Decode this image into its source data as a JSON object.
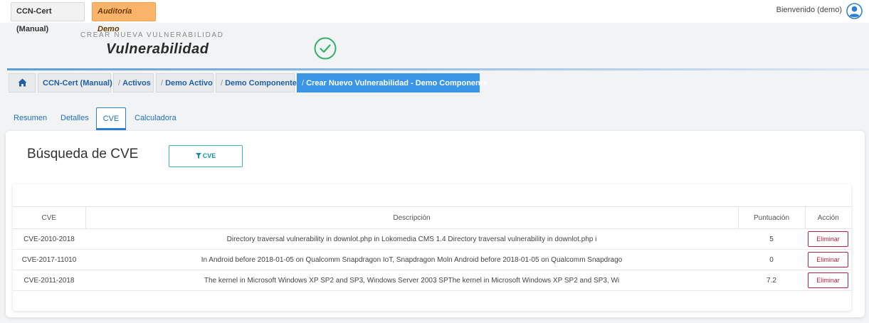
{
  "topbar": {
    "org_chip": "CCN-Cert (Manual)",
    "audit_chip": "Auditoría Demo",
    "welcome": "Bienvenido (demo)",
    "user_icon": "user-circle-icon"
  },
  "header": {
    "subtitle": "CREAR NUEVA VULNERABILIDAD",
    "title": "Vulnerabilidad",
    "status_icon": "check-circle-icon",
    "status_color": "#2fb36a"
  },
  "breadcrumb": {
    "home_icon": "home-icon",
    "items": [
      "CCN-Cert (Manual)",
      "Activos",
      "Demo Activo",
      "Demo Componente",
      "Crear Nuevo Vulnerabilidad - Demo Componente"
    ],
    "separator": "/"
  },
  "tabs": [
    "Resumen",
    "Detalles",
    "CVE",
    "Calculadora"
  ],
  "active_tab": "CVE",
  "card": {
    "title": "Búsqueda de CVE",
    "filter_button": "CVE",
    "filter_icon": "filter-icon"
  },
  "table": {
    "headers": [
      "CVE",
      "Descripción",
      "Puntuación",
      "Acción"
    ],
    "rows": [
      {
        "cve": "CVE-2010-2018",
        "description": "Directory traversal vulnerability in downlot.php in Lokomedia CMS 1.4 Directory traversal vulnerability in downlot.php i",
        "score": "5",
        "action": "Eliminar"
      },
      {
        "cve": "CVE-2017-11010",
        "description": "In Android before 2018-01-05 on Qualcomm Snapdragon IoT, Snapdragon Moln Android before 2018-01-05 on Qualcomm Snapdrago",
        "score": "0",
        "action": "Eliminar"
      },
      {
        "cve": "CVE-2011-2018",
        "description": "The kernel in Microsoft Windows XP SP2 and SP3, Windows Server 2003 SPThe kernel in Microsoft Windows XP SP2 and SP3, Wi",
        "score": "7.2",
        "action": "Eliminar"
      }
    ]
  },
  "colors": {
    "accent": "#3b96e8",
    "audit": "#fbb46a",
    "danger": "#b0243f",
    "teal": "#40b3bd"
  }
}
